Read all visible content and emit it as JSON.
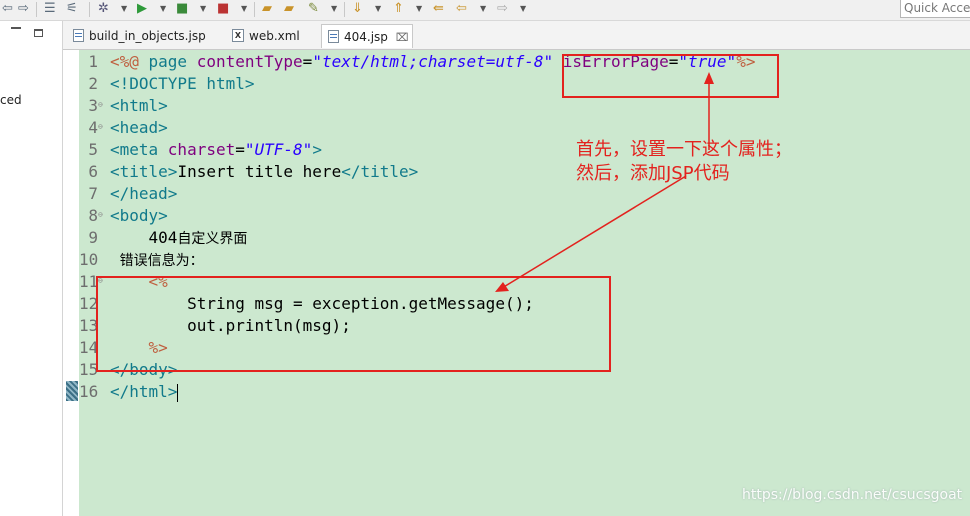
{
  "toolbar": {
    "quick_access_label": "Quick Access",
    "icons": [
      "back-icon",
      "forward-icon",
      "task-icon",
      "link-icon",
      "debug-icon",
      "run-icon",
      "external-tools-icon",
      "coverage-icon",
      "open-folder-icon",
      "open-type-icon",
      "pin-icon",
      "next-annotation-icon",
      "previous-annotation-icon",
      "last-edit-icon",
      "back-nav-icon",
      "forward-nav-icon"
    ]
  },
  "left_panel": {
    "partial_text": "ced"
  },
  "tabs": [
    {
      "label": "build_in_objects.jsp",
      "icon": "jsp-file-icon",
      "active": false
    },
    {
      "label": "web.xml",
      "icon": "xml-file-icon",
      "active": false
    },
    {
      "label": "404.jsp",
      "icon": "jsp-file-icon",
      "active": true,
      "close": "⌧"
    }
  ],
  "editor": {
    "lines": [
      {
        "number": "1",
        "fold": "",
        "tokens": [
          {
            "t": "<%@ ",
            "k": "dir"
          },
          {
            "t": "page ",
            "k": "tag"
          },
          {
            "t": "contentType",
            "k": "attr"
          },
          {
            "t": "=",
            "k": "plain"
          },
          {
            "t": "\"text/html;charset=utf-8\"",
            "k": "str"
          },
          {
            "t": " ",
            "k": "plain"
          },
          {
            "t": "isErrorPage",
            "k": "attr"
          },
          {
            "t": "=",
            "k": "plain"
          },
          {
            "t": "\"true\"",
            "k": "str"
          },
          {
            "t": "%>",
            "k": "dir"
          }
        ]
      },
      {
        "number": "2",
        "fold": "",
        "tokens": [
          {
            "t": "<!DOCTYPE html>",
            "k": "tag"
          }
        ]
      },
      {
        "number": "3",
        "fold": "⊖",
        "tokens": [
          {
            "t": "<html>",
            "k": "tag"
          }
        ]
      },
      {
        "number": "4",
        "fold": "⊖",
        "tokens": [
          {
            "t": "<head>",
            "k": "tag"
          }
        ]
      },
      {
        "number": "5",
        "fold": "",
        "tokens": [
          {
            "t": "<meta ",
            "k": "tag"
          },
          {
            "t": "charset",
            "k": "attr"
          },
          {
            "t": "=",
            "k": "plain"
          },
          {
            "t": "\"UTF-8\"",
            "k": "str"
          },
          {
            "t": ">",
            "k": "tag"
          }
        ]
      },
      {
        "number": "6",
        "fold": "",
        "tokens": [
          {
            "t": "<title>",
            "k": "tag"
          },
          {
            "t": "Insert title here",
            "k": "plain"
          },
          {
            "t": "</title>",
            "k": "tag"
          }
        ]
      },
      {
        "number": "7",
        "fold": "",
        "tokens": [
          {
            "t": "</head>",
            "k": "tag"
          }
        ]
      },
      {
        "number": "8",
        "fold": "⊖",
        "tokens": [
          {
            "t": "<body>",
            "k": "tag"
          }
        ]
      },
      {
        "number": "9",
        "fold": "",
        "tokens": [
          {
            "t": "    404",
            "k": "plain"
          },
          {
            "t": "自定义界面",
            "k": "cjk"
          }
        ]
      },
      {
        "number": "10",
        "fold": "",
        "tokens": [
          {
            "t": " ",
            "k": "plain"
          },
          {
            "t": "错误信息为：",
            "k": "cjk"
          }
        ]
      },
      {
        "number": "11",
        "fold": "⊖",
        "tokens": [
          {
            "t": "    <%",
            "k": "dir"
          }
        ]
      },
      {
        "number": "12",
        "fold": "",
        "tokens": [
          {
            "t": "        String msg = exception.getMessage();",
            "k": "plain"
          }
        ]
      },
      {
        "number": "13",
        "fold": "",
        "tokens": [
          {
            "t": "        out.println(msg);",
            "k": "plain"
          }
        ]
      },
      {
        "number": "14",
        "fold": "",
        "tokens": [
          {
            "t": "    %>",
            "k": "dir"
          }
        ]
      },
      {
        "number": "15",
        "fold": "",
        "tokens": [
          {
            "t": "</body>",
            "k": "tag"
          }
        ]
      },
      {
        "number": "16",
        "fold": "",
        "tokens": [
          {
            "t": "</html>",
            "k": "tag"
          }
        ],
        "caret": true
      }
    ]
  },
  "annotation": {
    "line1": "首先，设置一下这个属性；",
    "line2": "然后，添加JSP代码",
    "color": "#e3221e"
  },
  "colors": {
    "editor_background": "#cce8cf",
    "tag": "#117a8b",
    "attribute": "#7f007f",
    "string": "#2a00ff",
    "directive": "#bf5f3f"
  },
  "watermark": "https://blog.csdn.net/csucsgoat"
}
